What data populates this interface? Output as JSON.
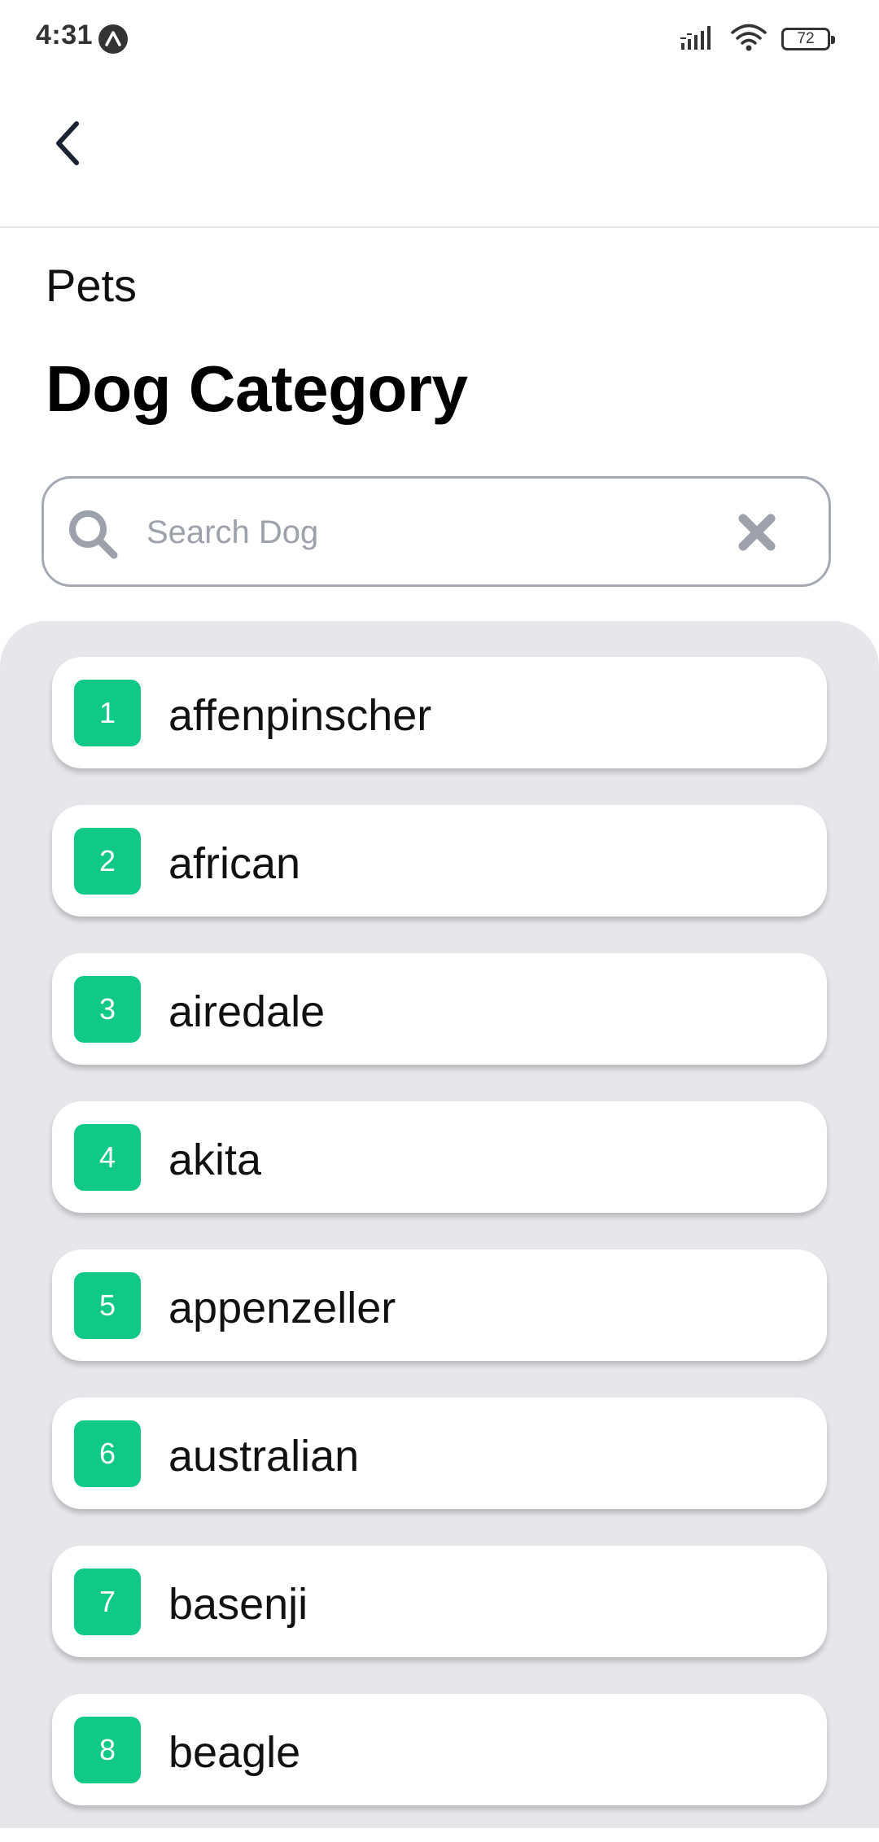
{
  "status_bar": {
    "time": "4:31",
    "battery": "72"
  },
  "header": {
    "breadcrumb": "Pets",
    "title": "Dog Category"
  },
  "search": {
    "placeholder": "Search Dog",
    "value": ""
  },
  "colors": {
    "badge": "#10c987",
    "panel_bg": "#e5e7eb",
    "search_border": "#a4a9b3",
    "icon_gray": "#9ca1ab"
  },
  "icons": {
    "back": "chevron-left-icon",
    "search": "search-icon",
    "clear": "close-icon"
  },
  "breeds": [
    {
      "index": "1",
      "name": "affenpinscher"
    },
    {
      "index": "2",
      "name": "african"
    },
    {
      "index": "3",
      "name": "airedale"
    },
    {
      "index": "4",
      "name": "akita"
    },
    {
      "index": "5",
      "name": "appenzeller"
    },
    {
      "index": "6",
      "name": "australian"
    },
    {
      "index": "7",
      "name": "basenji"
    },
    {
      "index": "8",
      "name": "beagle"
    }
  ]
}
